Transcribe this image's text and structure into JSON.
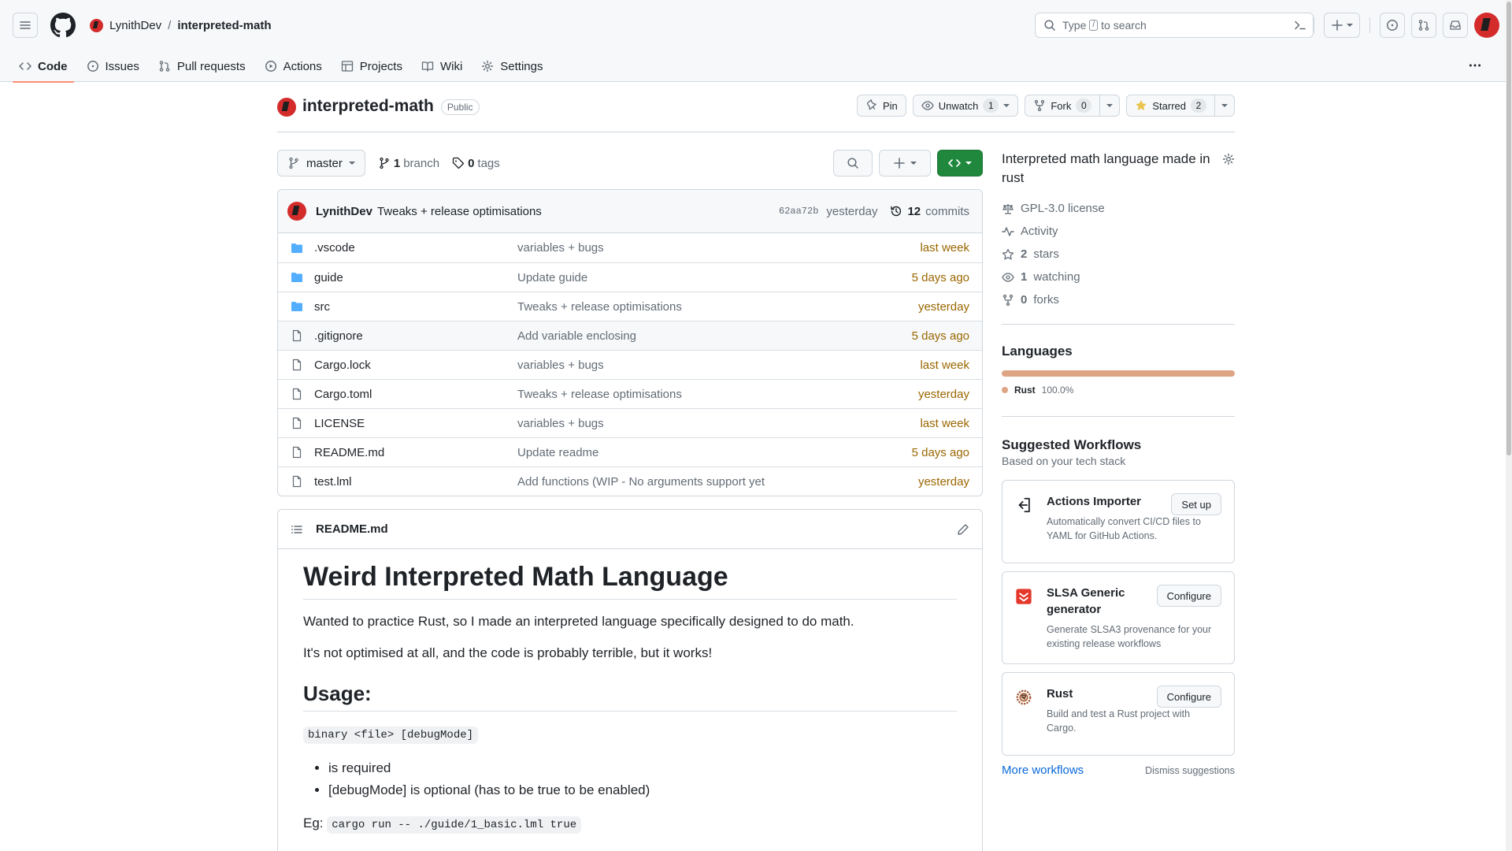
{
  "header": {
    "owner": "LynithDev",
    "separator": "/",
    "repo": "interpreted-math",
    "search_prefix": "Type",
    "search_key": "/",
    "search_suffix": "to search"
  },
  "nav": {
    "tabs": [
      {
        "label": "Code",
        "icon": "code-icon"
      },
      {
        "label": "Issues",
        "icon": "issue-icon"
      },
      {
        "label": "Pull requests",
        "icon": "pull-request-icon"
      },
      {
        "label": "Actions",
        "icon": "play-icon"
      },
      {
        "label": "Projects",
        "icon": "table-icon"
      },
      {
        "label": "Wiki",
        "icon": "book-icon"
      },
      {
        "label": "Settings",
        "icon": "gear-icon"
      }
    ]
  },
  "repo": {
    "name": "interpreted-math",
    "visibility": "Public",
    "pin_label": "Pin",
    "watch_label": "Unwatch",
    "watch_count": "1",
    "fork_label": "Fork",
    "fork_count": "0",
    "star_label": "Starred",
    "star_count": "2"
  },
  "toolbar": {
    "branch": "master",
    "branch_count": "1",
    "branch_label": "branch",
    "tag_count": "0",
    "tag_label": "tags"
  },
  "commit": {
    "author": "LynithDev",
    "message": "Tweaks + release optimisations",
    "sha": "62aa72b",
    "time": "yesterday",
    "count": "12",
    "count_label": "commits"
  },
  "files": [
    {
      "name": ".vscode",
      "type": "dir",
      "message": "variables + bugs",
      "time": "last week"
    },
    {
      "name": "guide",
      "type": "dir",
      "message": "Update guide",
      "time": "5 days ago"
    },
    {
      "name": "src",
      "type": "dir",
      "message": "Tweaks + release optimisations",
      "time": "yesterday"
    },
    {
      "name": ".gitignore",
      "type": "file",
      "message": "Add variable enclosing",
      "time": "5 days ago"
    },
    {
      "name": "Cargo.lock",
      "type": "file",
      "message": "variables + bugs",
      "time": "last week"
    },
    {
      "name": "Cargo.toml",
      "type": "file",
      "message": "Tweaks + release optimisations",
      "time": "yesterday"
    },
    {
      "name": "LICENSE",
      "type": "file",
      "message": "variables + bugs",
      "time": "last week"
    },
    {
      "name": "README.md",
      "type": "file",
      "message": "Update readme",
      "time": "5 days ago"
    },
    {
      "name": "test.lml",
      "type": "file",
      "message": "Add functions (WIP - No arguments support yet",
      "time": "yesterday"
    }
  ],
  "readme": {
    "filename": "README.md",
    "h1": "Weird Interpreted Math Language",
    "p1": "Wanted to practice Rust, so I made an interpreted language specifically designed to do math.",
    "p2": "It's not optimised at all, and the code is probably terrible, but it works!",
    "h2": "Usage:",
    "usage_code": "binary <file> [debugMode]",
    "bullets": [
      "is required",
      "[debugMode] is optional (has to be true to be enabled)"
    ],
    "eg_label": "Eg:",
    "eg_code": "cargo run -- ./guide/1_basic.lml true"
  },
  "about": {
    "description": "Interpreted math language made in rust",
    "license": "GPL-3.0 license",
    "activity": "Activity",
    "stars_count": "2",
    "stars_label": "stars",
    "watching_count": "1",
    "watching_label": "watching",
    "forks_count": "0",
    "forks_label": "forks"
  },
  "languages": {
    "heading": "Languages",
    "items": [
      {
        "name": "Rust",
        "percent": "100.0%",
        "color": "#dea584"
      }
    ]
  },
  "workflows": {
    "heading": "Suggested Workflows",
    "subheading": "Based on your tech stack",
    "items": [
      {
        "title": "Actions Importer",
        "desc": "Automatically convert CI/CD files to YAML for GitHub Actions.",
        "button": "Set up"
      },
      {
        "title": "SLSA Generic generator",
        "desc": "Generate SLSA3 provenance for your existing release workflows",
        "button": "Configure"
      },
      {
        "title": "Rust",
        "desc": "Build and test a Rust project with Cargo.",
        "button": "Configure"
      }
    ],
    "more": "More workflows",
    "dismiss": "Dismiss suggestions"
  },
  "colors": {
    "accent": "#0969da",
    "primary_button": "#1f883d",
    "tab_underline": "#fd8c73",
    "time_text": "#9a6700",
    "rust": "#dea584"
  }
}
